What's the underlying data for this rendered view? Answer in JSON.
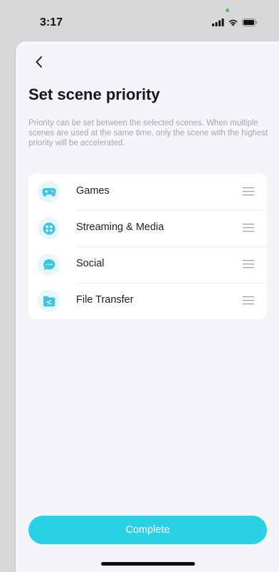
{
  "status_bar": {
    "time": "3:17",
    "icons": [
      "signal-icon",
      "wifi-icon",
      "battery-icon"
    ]
  },
  "header": {
    "back_icon": "chevron-left-icon",
    "title": "Set scene priority",
    "description": "Priority can be set between the selected scenes. When multiple scenes are used at the same time, only the scene with the highest priority will be accelerated."
  },
  "scenes": [
    {
      "label": "Games",
      "icon": "gamepad-icon"
    },
    {
      "label": "Streaming & Media",
      "icon": "media-icon"
    },
    {
      "label": "Social",
      "icon": "chat-bubble-icon"
    },
    {
      "label": "File Transfer",
      "icon": "folder-share-icon"
    }
  ],
  "actions": {
    "complete_label": "Complete"
  },
  "colors": {
    "accent": "#2ad0e3",
    "icon_bg": "#e6f7fb",
    "sheet_bg": "#f3f5f9"
  }
}
